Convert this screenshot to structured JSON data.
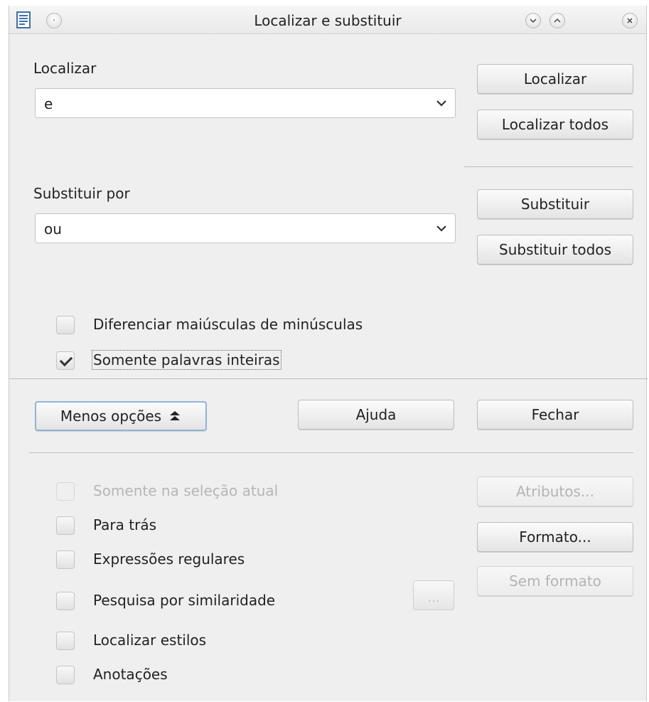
{
  "window": {
    "title": "Localizar e substituir",
    "icons": [
      "document-icon",
      "window-menu-icon",
      "minimize-icon",
      "maximize-icon",
      "close-icon"
    ]
  },
  "find": {
    "label": "Localizar",
    "value": "e",
    "find_button": "Localizar",
    "find_all_button": "Localizar todos"
  },
  "replace": {
    "label": "Substituir por",
    "value": "ou",
    "replace_button": "Substituir",
    "replace_all_button": "Substituir todos"
  },
  "options": {
    "match_case": {
      "label": "Diferenciar maiúsculas de minúsculas",
      "checked": false
    },
    "whole_words": {
      "label": "Somente palavras inteiras",
      "checked": true
    }
  },
  "actions": {
    "less_options": "Menos opções",
    "help": "Ajuda",
    "close": "Fechar"
  },
  "more_options": {
    "current_selection": {
      "label": "Somente na seleção atual",
      "checked": false,
      "enabled": false
    },
    "backwards": {
      "label": "Para trás",
      "checked": false
    },
    "regex": {
      "label": "Expressões regulares",
      "checked": false
    },
    "similarity": {
      "label": "Pesquisa por similaridade",
      "checked": false,
      "settings_button": "..."
    },
    "styles": {
      "label": "Localizar estilos",
      "checked": false
    },
    "comments": {
      "label": "Anotações",
      "checked": false
    },
    "attributes_button": "Atributos...",
    "format_button": "Formato...",
    "no_format_button": "Sem formato"
  },
  "colors": {
    "background": "#efefef",
    "focus": "#8fb4d8",
    "disabled_text": "#b6b6b6"
  }
}
